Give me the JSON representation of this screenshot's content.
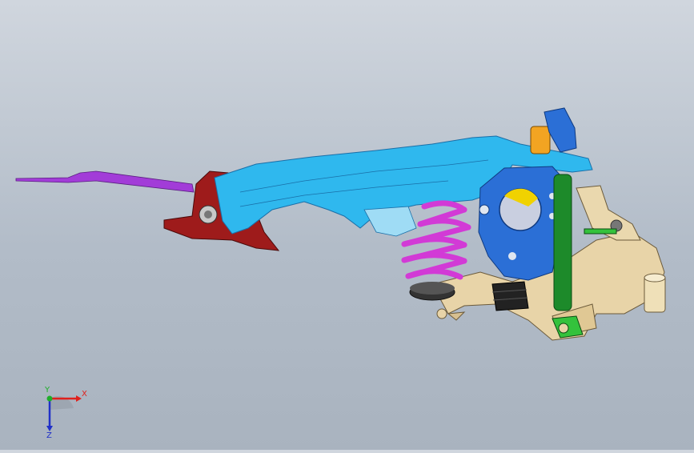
{
  "scene": {
    "name": "suspension-assembly",
    "colors": {
      "background_top": "#d0d6de",
      "background_bottom": "#a9b3bf",
      "trailing_arm": "#2fb8ee",
      "trailing_arm_dark": "#1a6fa8",
      "bracket": "#9e1b1b",
      "rod": "#a23cd8",
      "spring": "#d23ad6",
      "knuckle": "#2b6fd6",
      "damper": "#1d8a2a",
      "subframe": "#e8d4a8",
      "bushing": "#f2a422",
      "boot": "#222222"
    }
  },
  "triad": {
    "x_label": "X",
    "y_label": "Y",
    "z_label": "Z",
    "x_color": "#e0211c",
    "y_color": "#1fae2a",
    "z_color": "#2030c8"
  }
}
